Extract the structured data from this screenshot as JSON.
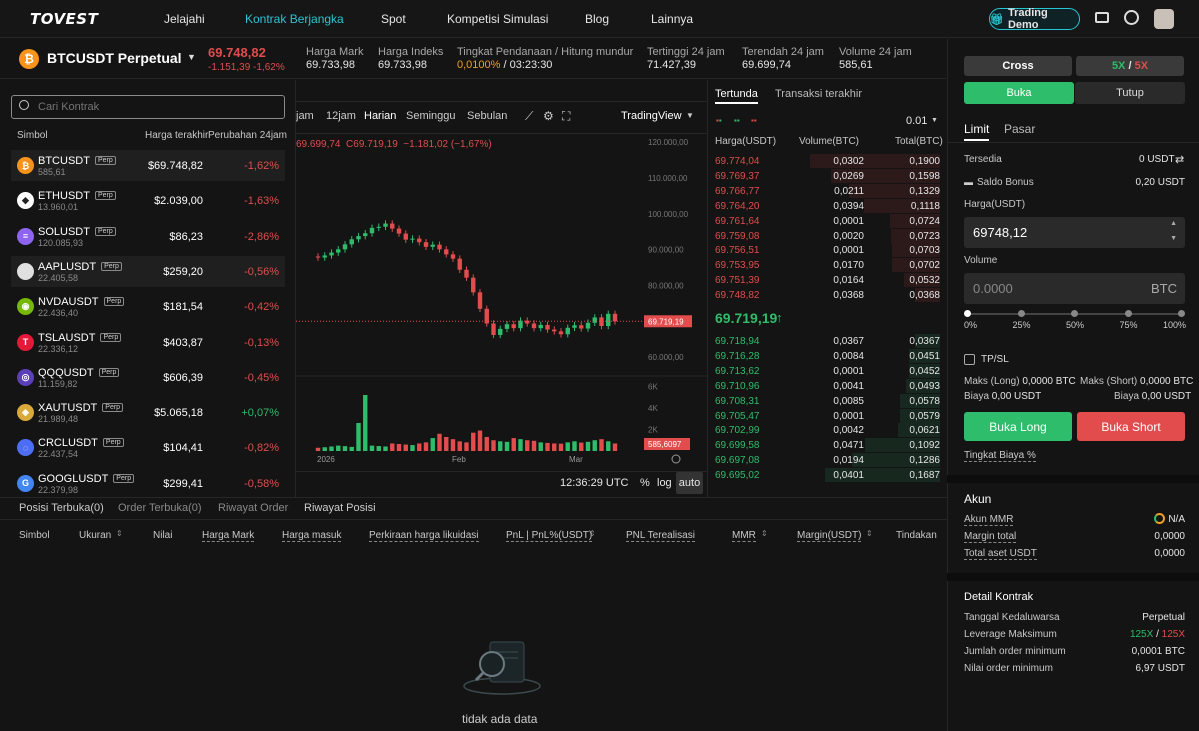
{
  "nav": {
    "logo": "TOVEST",
    "items": [
      "Jelajahi",
      "Kontrak Berjangka",
      "Spot",
      "Kompetisi Simulasi",
      "Blog",
      "Lainnya"
    ],
    "demo_label": "Trading Demo"
  },
  "ticker": {
    "symbol": "BTCUSDT Perpetual",
    "price": "69.748,82",
    "change": "-1.151,39 -1,62%",
    "mark_label": "Harga Mark",
    "mark": "69.733,98",
    "index_label": "Harga Indeks",
    "index": "69.733,98",
    "funding_label": "Tingkat Pendanaan / Hitung mundur",
    "funding_rate": "0,0100%",
    "funding_sep": " / ",
    "countdown": "03:23:30",
    "high_label": "Tertinggi 24 jam",
    "high": "71.427,39",
    "low_label": "Terendah 24 jam",
    "low": "69.699,74",
    "vol_label": "Volume 24 jam",
    "vol": "585,61"
  },
  "search": {
    "placeholder": "Cari Kontrak"
  },
  "list_headers": {
    "symbol": "Simbol",
    "last": "Harga terakhir",
    "change": "Perubahan 24jam"
  },
  "contracts": [
    {
      "symbol": "BTCUSDT",
      "vol": "585,61",
      "price": "$69.748,82",
      "change": "-1,62%",
      "up": false,
      "color": "#f7931a",
      "glyph": "₿"
    },
    {
      "symbol": "ETHUSDT",
      "vol": "13.960,01",
      "price": "$2.039,00",
      "change": "-1,63%",
      "up": false,
      "color": "#ffffff",
      "glyph": "◆"
    },
    {
      "symbol": "SOLUSDT",
      "vol": "120.085,93",
      "price": "$86,23",
      "change": "-2,86%",
      "up": false,
      "color": "#8e63f0",
      "glyph": "≡"
    },
    {
      "symbol": "AAPLUSDT",
      "vol": "22.405,58",
      "price": "$259,20",
      "change": "-0,56%",
      "up": false,
      "color": "#e0e0e0",
      "glyph": ""
    },
    {
      "symbol": "NVDAUSDT",
      "vol": "22.436,40",
      "price": "$181,54",
      "change": "-0,42%",
      "up": false,
      "color": "#76b900",
      "glyph": "◉"
    },
    {
      "symbol": "TSLAUSDT",
      "vol": "22.336,12",
      "price": "$403,87",
      "change": "-0,13%",
      "up": false,
      "color": "#e31937",
      "glyph": "T"
    },
    {
      "symbol": "QQQUSDT",
      "vol": "11.159,82",
      "price": "$606,39",
      "change": "-0,45%",
      "up": false,
      "color": "#5a3fb8",
      "glyph": "◎"
    },
    {
      "symbol": "XAUTUSDT",
      "vol": "21.989,48",
      "price": "$5.065,18",
      "change": "+0,07%",
      "up": true,
      "color": "#d9a93a",
      "glyph": "◈"
    },
    {
      "symbol": "CRCLUSDT",
      "vol": "22.437,54",
      "price": "$104,41",
      "change": "-0,82%",
      "up": false,
      "color": "#4c6ef5",
      "glyph": "◌"
    },
    {
      "symbol": "GOOGLUSDT",
      "vol": "22.379,98",
      "price": "$299,41",
      "change": "-0,58%",
      "up": false,
      "color": "#4285f4",
      "glyph": "G"
    }
  ],
  "perp_badge": "Perp",
  "chart_toolbar": {
    "tf": [
      "jam",
      "12jam",
      "Harian",
      "Seminggu",
      "Sebulan"
    ],
    "provider": "TradingView"
  },
  "chart_legend": "69.699,74  C69.719,19  −1.181,02 (−1,67%)",
  "chart_data": {
    "type": "candlestick",
    "y_ticks": [
      "120.000,00",
      "110.000,00",
      "100.000,00",
      "90.000,00",
      "80.000,00",
      "60.000,00"
    ],
    "last_price_tag": "69.719,19",
    "volume_ticks": [
      "6K",
      "4K",
      "2K"
    ],
    "volume_tag": "585,6097",
    "x_labels": [
      "2026",
      "Feb",
      "Mar"
    ],
    "close_series": [
      87500,
      88100,
      88900,
      89800,
      91200,
      92600,
      93500,
      94300,
      95800,
      96100,
      97000,
      95600,
      94200,
      92500,
      92800,
      91800,
      90500,
      91100,
      89800,
      88400,
      87200,
      84100,
      81900,
      77800,
      73200,
      69100,
      65900,
      67600,
      68900,
      67800,
      69900,
      69100,
      67800,
      68700,
      67400,
      66900,
      66100,
      67900,
      68600,
      67700,
      69300,
      70800,
      68400,
      71800,
      69700
    ]
  },
  "chart_bottom": {
    "time": "12:36:29 UTC",
    "pct": "%",
    "log": "log",
    "auto": "auto"
  },
  "orderbook": {
    "tabs": [
      "Tertunda",
      "Transaksi terakhir"
    ],
    "precision": "0.01",
    "headers": [
      "Harga(USDT)",
      "Volume(BTC)",
      "Total(BTC)"
    ],
    "asks": [
      [
        "69.774,04",
        "0,0302",
        "0,1900"
      ],
      [
        "69.769,37",
        "0,0269",
        "0,1598"
      ],
      [
        "69.766,77",
        "0,0211",
        "0,1329"
      ],
      [
        "69.764,20",
        "0,0394",
        "0,1118"
      ],
      [
        "69.761,64",
        "0,0001",
        "0,0724"
      ],
      [
        "69.759,08",
        "0,0020",
        "0,0723"
      ],
      [
        "69.756,51",
        "0,0001",
        "0,0703"
      ],
      [
        "69.753,95",
        "0,0170",
        "0,0702"
      ],
      [
        "69.751,39",
        "0,0164",
        "0,0532"
      ],
      [
        "69.748,82",
        "0,0368",
        "0,0368"
      ]
    ],
    "mid": "69.719,19",
    "bids": [
      [
        "69.718,94",
        "0,0367",
        "0,0367"
      ],
      [
        "69.716,28",
        "0,0084",
        "0,0451"
      ],
      [
        "69.713,62",
        "0,0001",
        "0,0452"
      ],
      [
        "69.710,96",
        "0,0041",
        "0,0493"
      ],
      [
        "69.708,31",
        "0,0085",
        "0,0578"
      ],
      [
        "69.705,47",
        "0,0001",
        "0,0579"
      ],
      [
        "69.702,99",
        "0,0042",
        "0,0621"
      ],
      [
        "69.699,58",
        "0,0471",
        "0,1092"
      ],
      [
        "69.697,08",
        "0,0194",
        "0,1286"
      ],
      [
        "69.695,02",
        "0,0401",
        "0,1687"
      ]
    ]
  },
  "bottom": {
    "tabs": [
      "Posisi Terbuka(0)",
      "Order Terbuka(0)",
      "Riwayat Order",
      "Riwayat Posisi"
    ],
    "columns": [
      "Simbol",
      "Ukuran",
      "Nilai",
      "Harga Mark",
      "Harga masuk",
      "Perkiraan harga likuidasi",
      "PnL | PnL%(USDT)",
      "PNL Terealisasi",
      "MMR",
      "Margin(USDT)",
      "Tindakan"
    ],
    "empty": "tidak ada data"
  },
  "order_form": {
    "margin_mode": "Cross",
    "leverage_long": "5X",
    "leverage_sep": "/",
    "leverage_short": "5X",
    "open": "Buka",
    "close": "Tutup",
    "limit": "Limit",
    "market": "Pasar",
    "available_label": "Tersedia",
    "available": "0 USDT",
    "bonus_label": "Saldo Bonus",
    "bonus": "0,20 USDT",
    "price_label": "Harga(USDT)",
    "price": "69748,12",
    "volume_label": "Volume",
    "volume_placeholder": "0.0000",
    "volume_unit": "BTC",
    "slider_marks": [
      "0%",
      "25%",
      "50%",
      "75%",
      "100%"
    ],
    "slider_value": 0,
    "tpsl": "TP/SL",
    "max_long_label": "Maks (Long)",
    "max_long": "0,0000 BTC",
    "max_short_label": "Maks (Short)",
    "max_short": "0,0000 BTC",
    "fee_label": "Biaya",
    "fee_long": "0,00 USDT",
    "fee_short": "0,00 USDT",
    "buy_long": "Buka Long",
    "buy_short": "Buka Short",
    "fee_rate": "Tingkat Biaya %"
  },
  "account": {
    "title": "Akun",
    "mmr_label": "Akun MMR",
    "mmr": "N/A",
    "margin_label": "Margin total",
    "margin": "0,0000",
    "assets_label": "Total aset USDT",
    "assets": "0,0000"
  },
  "contract": {
    "title": "Detail Kontrak",
    "expiry_label": "Tanggal Kedaluwarsa",
    "expiry": "Perpetual",
    "leverage_label": "Leverage Maksimum",
    "leverage_long": "125X",
    "leverage_sep": "/",
    "leverage_short": "125X",
    "min_qty_label": "Jumlah order minimum",
    "min_qty": "0,0001 BTC",
    "min_val_label": "Nilai order minimum",
    "min_val": "6,97 USDT"
  },
  "colors": {
    "accent": "#27c6d4",
    "up": "#2ebd6b",
    "down": "#e24c4c",
    "orange": "#f0a020"
  }
}
